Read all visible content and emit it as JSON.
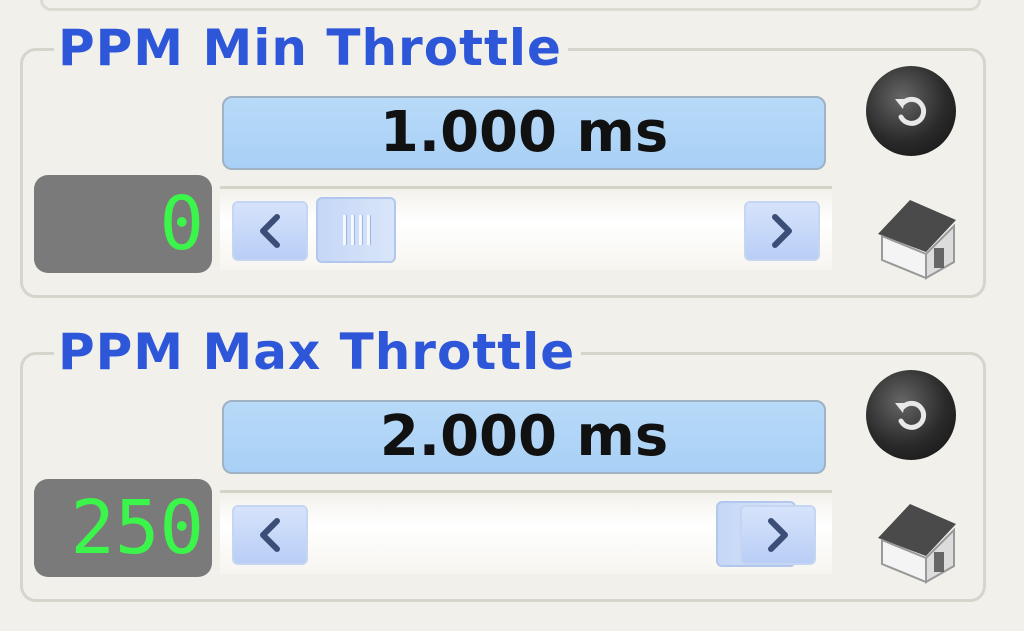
{
  "groups": [
    {
      "title": "PPM Min Throttle",
      "value_text": "1.000 ms",
      "lcd_value": "0",
      "slider_fraction": 0.0
    },
    {
      "title": "PPM Max Throttle",
      "value_text": "2.000 ms",
      "lcd_value": "250",
      "slider_fraction": 1.0
    }
  ],
  "icons": {
    "reset": "undo-icon",
    "home": "home-icon",
    "scroll_left": "chevron-left-icon",
    "scroll_right": "chevron-right-icon"
  },
  "colors": {
    "title": "#2d56d8",
    "lcd_text": "#3cf54a",
    "lcd_background": "#7a7a7a",
    "value_background": "#b8daf8"
  }
}
